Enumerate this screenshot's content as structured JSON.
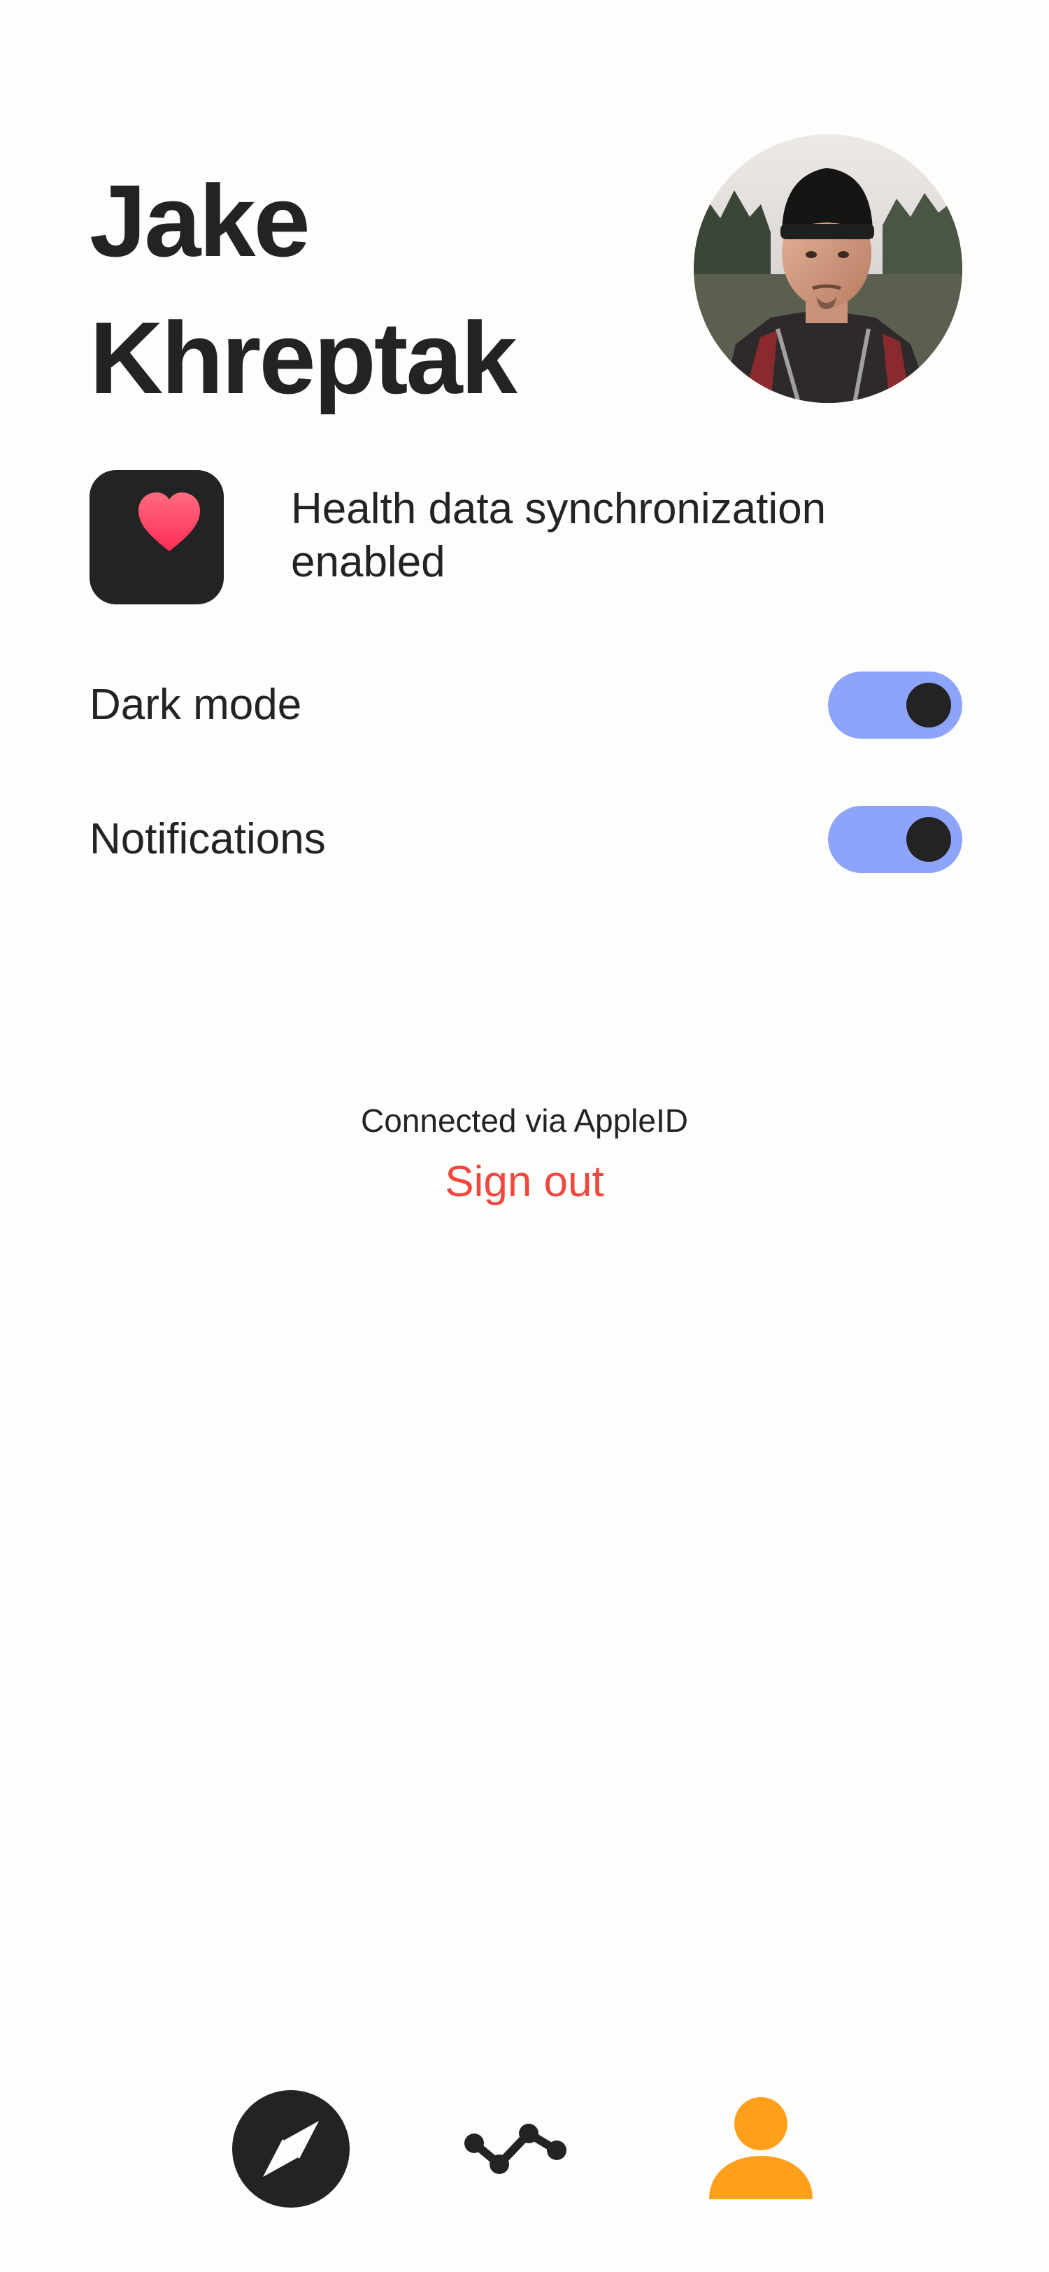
{
  "profile": {
    "first_name": "Jake",
    "last_name": "Khreptak"
  },
  "health": {
    "icon": "heart-icon",
    "status_text": "Health data synchronization enabled"
  },
  "settings": [
    {
      "label": "Dark mode",
      "enabled": true
    },
    {
      "label": "Notifications",
      "enabled": true
    }
  ],
  "account": {
    "connected_text": "Connected via AppleID",
    "sign_out_label": "Sign out"
  },
  "tab_bar": {
    "tabs": [
      {
        "icon": "compass-icon",
        "selected": false
      },
      {
        "icon": "chart-line-icon",
        "selected": false
      },
      {
        "icon": "person-icon",
        "selected": true
      }
    ]
  },
  "colors": {
    "text": "#232323",
    "background": "#FDFDFC",
    "toggle_track": "#8EA4FA",
    "sign_out": "#F0483E",
    "active_tab": "#FF9F1C",
    "heart": "#FF2D55"
  }
}
